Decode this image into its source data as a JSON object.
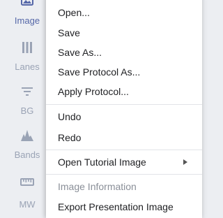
{
  "sidebar": {
    "items": [
      {
        "label": "Image",
        "icon": "image-icon"
      },
      {
        "label": "Lanes",
        "icon": "lanes-icon"
      },
      {
        "label": "BG",
        "icon": "filter-icon"
      },
      {
        "label": "Bands",
        "icon": "bands-icon"
      },
      {
        "label": "MW",
        "icon": "ruler-icon"
      }
    ],
    "active_color": "#5567a8",
    "inactive_color": "#9aa3b5"
  },
  "menu": {
    "items": [
      {
        "label": "Open..."
      },
      {
        "label": "Save"
      },
      {
        "label": "Save As..."
      },
      {
        "label": "Save Protocol As..."
      },
      {
        "label": "Apply Protocol..."
      },
      {
        "label": "Undo"
      },
      {
        "label": "Redo"
      },
      {
        "label": "Open Tutorial Image",
        "submenu": true
      },
      {
        "label": "Image Information",
        "disabled": true
      },
      {
        "label": "Export Presentation Image"
      }
    ]
  }
}
